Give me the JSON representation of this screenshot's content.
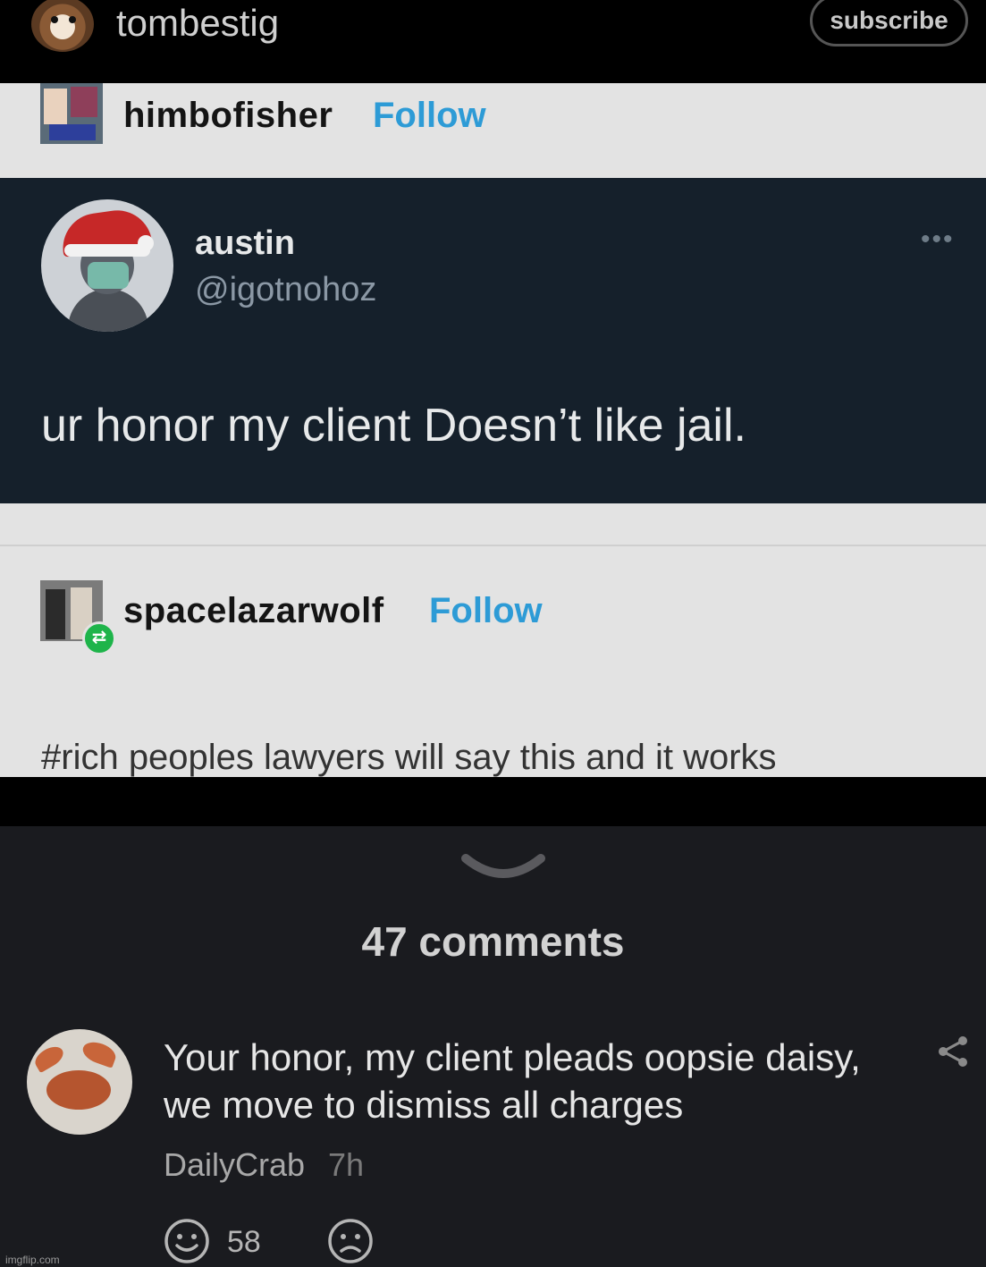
{
  "header": {
    "blog_name": "tombestig",
    "subscribe_label": "subscribe"
  },
  "reblog_chain": [
    {
      "username": "himbofisher",
      "follow_label": "Follow"
    },
    {
      "username": "spacelazarwolf",
      "follow_label": "Follow",
      "tags": "#rich peoples lawyers will say this and it works"
    }
  ],
  "tweet": {
    "display_name": "austin",
    "handle": "@igotnohoz",
    "more": "•••",
    "text": "ur honor my client Doesn’t like jail."
  },
  "comments_section": {
    "count_label": "47 comments",
    "comment": {
      "text": "Your honor, my client pleads oopsie daisy, we move to dismiss all charges",
      "username": "DailyCrab",
      "time": "7h",
      "like_count": "58"
    }
  },
  "icons": {
    "reblog": "reblog-icon",
    "share": "share-icon",
    "chevron": "chevron-down-icon",
    "smile": "smile-reaction-icon",
    "frown": "frown-reaction-icon"
  },
  "watermark": "imgflip.com",
  "colors": {
    "follow_blue": "#2d9bd6",
    "tweet_bg": "#15202b",
    "panel_bg": "#e3e3e3",
    "comments_bg": "#1a1b1f",
    "reblog_green": "#1eb44a"
  }
}
